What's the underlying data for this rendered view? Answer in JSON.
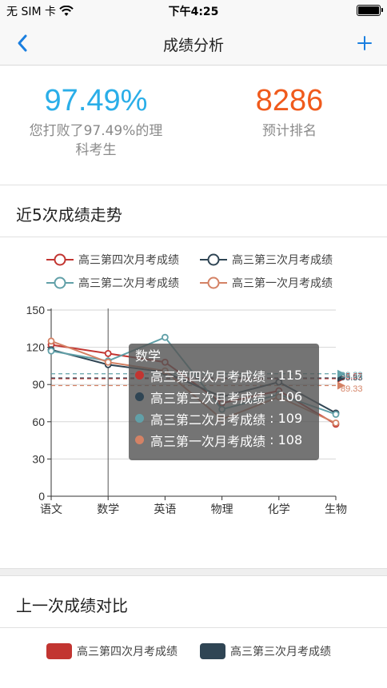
{
  "status_bar": {
    "carrier": "无 SIM 卡",
    "time": "下午4:25"
  },
  "nav": {
    "title": "成绩分析",
    "back_icon": "chevron-left-icon",
    "add_icon": "plus-icon",
    "accent": "#1a7fe0"
  },
  "stats": {
    "percent_value": "97.49%",
    "percent_label_line1": "您打败了97.49%的理",
    "percent_label_line2": "科考生",
    "rank_value": "8286",
    "rank_label": "预计排名",
    "percent_color": "#2aaee8",
    "rank_color": "#f05a1c"
  },
  "trend_section": {
    "title": "近5次成绩走势"
  },
  "compare_section": {
    "title": "上一次成绩对比"
  },
  "chart_data": {
    "type": "line",
    "categories": [
      "语文",
      "数学",
      "英语",
      "物理",
      "化学",
      "生物"
    ],
    "ylim": [
      0,
      150
    ],
    "yticks": [
      0,
      30,
      60,
      90,
      120,
      150
    ],
    "grid": true,
    "legend_position": "top",
    "series": [
      {
        "name": "高三第四次月考成绩",
        "color": "#c23531",
        "values": [
          122,
          115,
          108,
          75,
          85,
          58
        ]
      },
      {
        "name": "高三第三次月考成绩",
        "color": "#2f4554",
        "values": [
          118,
          106,
          100,
          80,
          92,
          67
        ]
      },
      {
        "name": "高三第二次月考成绩",
        "color": "#61a0a8",
        "values": [
          117,
          109,
          128,
          70,
          82,
          66
        ]
      },
      {
        "name": "高三第一次月考成绩",
        "color": "#d48265",
        "values": [
          125,
          108,
          101,
          62,
          80,
          59
        ]
      }
    ],
    "mark_lines": [
      {
        "series": 0,
        "value": 94.67,
        "label": "95.67"
      },
      {
        "series": 1,
        "value": 95.33,
        "label": "95.33"
      },
      {
        "series": 2,
        "value": 98.67,
        "label": "98.33"
      },
      {
        "series": 3,
        "value": 89.17,
        "label": "89.33"
      }
    ],
    "tooltip": {
      "title": "数学",
      "rows": [
        {
          "name": "高三第四次月考成绩",
          "value": "115",
          "color": "#c23531"
        },
        {
          "name": "高三第三次月考成绩",
          "value": "106",
          "color": "#2f4554"
        },
        {
          "name": "高三第二次月考成绩",
          "value": "109",
          "color": "#61a0a8"
        },
        {
          "name": "高三第一次月考成绩",
          "value": "108",
          "color": "#d48265"
        }
      ]
    }
  },
  "compare_legend": [
    {
      "name": "高三第四次月考成绩",
      "color": "#c23531"
    },
    {
      "name": "高三第三次月考成绩",
      "color": "#2f4554"
    }
  ]
}
